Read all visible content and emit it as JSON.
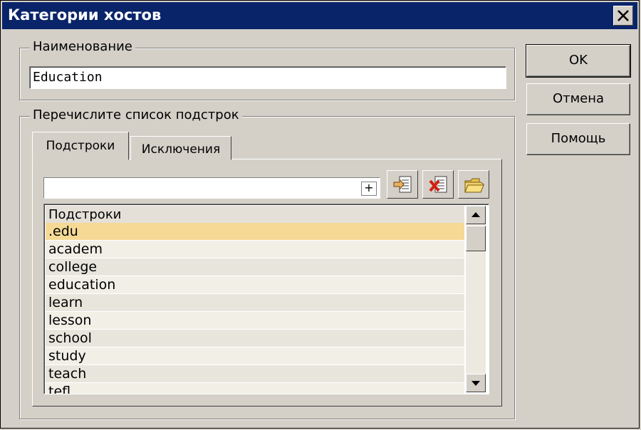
{
  "window": {
    "title": "Категории хостов",
    "colors": {
      "titlebar": "#0a246a",
      "face": "#d4d0c8",
      "selected_row": "#f5d995"
    }
  },
  "name_group": {
    "label": "Наименование",
    "value": "Education"
  },
  "buttons": {
    "ok": "OK",
    "cancel": "Отмена",
    "help": "Помощь"
  },
  "list_group": {
    "label": "Перечислите список подстрок",
    "tabs": [
      {
        "label": "Подстроки",
        "active": true
      },
      {
        "label": "Исключения",
        "active": false
      }
    ],
    "add_input": {
      "value": "",
      "plus": "+"
    },
    "toolbar_icons": [
      "add-item-icon",
      "delete-item-icon",
      "open-folder-icon"
    ],
    "list": {
      "header": "Подстроки",
      "items": [
        ".edu",
        "academ",
        "college",
        "education",
        "learn",
        "lesson",
        "school",
        "study",
        "teach",
        "tefl"
      ],
      "selected_index": 0
    }
  }
}
